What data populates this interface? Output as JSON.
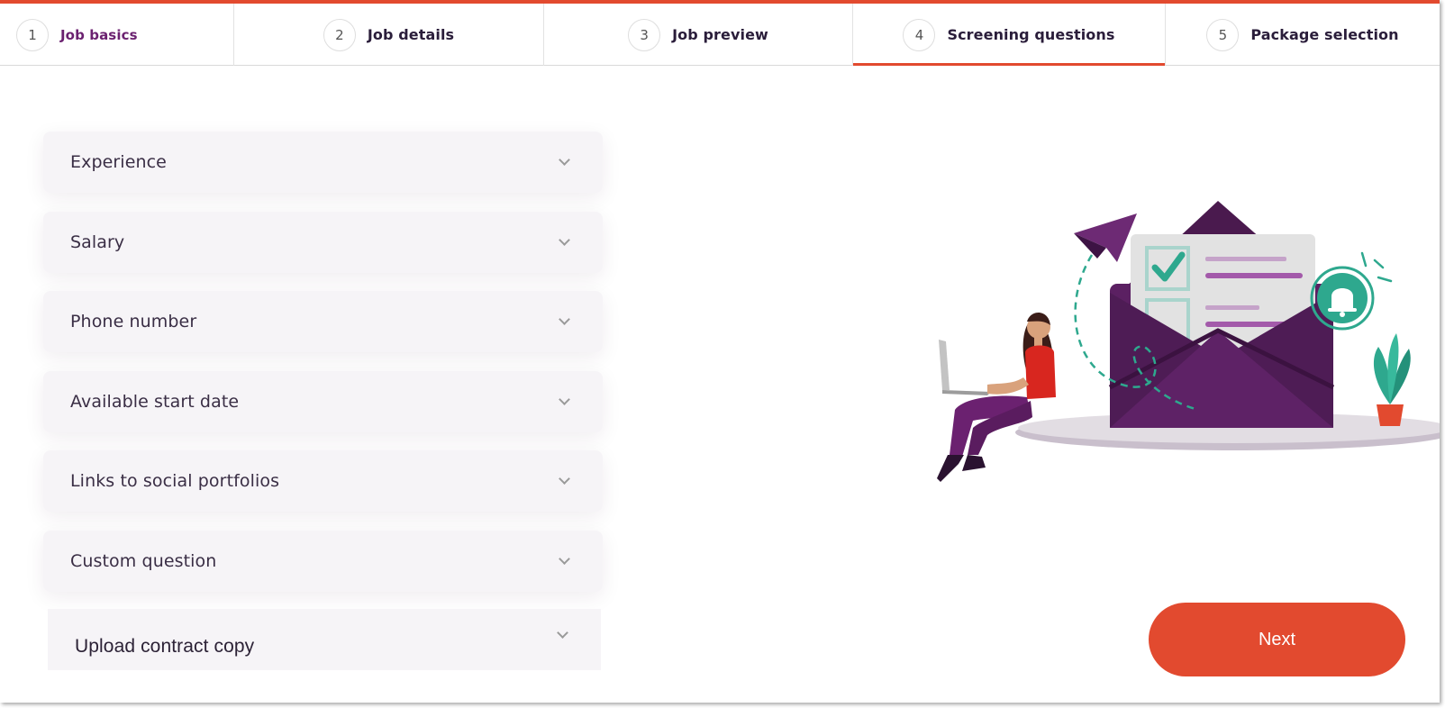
{
  "stepper": {
    "steps": [
      {
        "number": "1",
        "label": "Job basics"
      },
      {
        "number": "2",
        "label": "Job details"
      },
      {
        "number": "3",
        "label": "Job preview"
      },
      {
        "number": "4",
        "label": "Screening questions"
      },
      {
        "number": "5",
        "label": "Package selection"
      }
    ],
    "active_step": "4"
  },
  "questions": [
    {
      "label": "Experience"
    },
    {
      "label": "Salary"
    },
    {
      "label": "Phone number"
    },
    {
      "label": "Available start date"
    },
    {
      "label": "Links to social portfolios"
    },
    {
      "label": "Custom question"
    },
    {
      "label": "Upload contract copy"
    }
  ],
  "actions": {
    "next_label": "Next"
  },
  "icons": {
    "chevron": "chevron-down-icon",
    "illustration": "woman-laptop-envelope-illustration"
  },
  "colors": {
    "accent": "#e24a2f",
    "brand_purple": "#6b2170",
    "teal": "#2ea88e"
  }
}
